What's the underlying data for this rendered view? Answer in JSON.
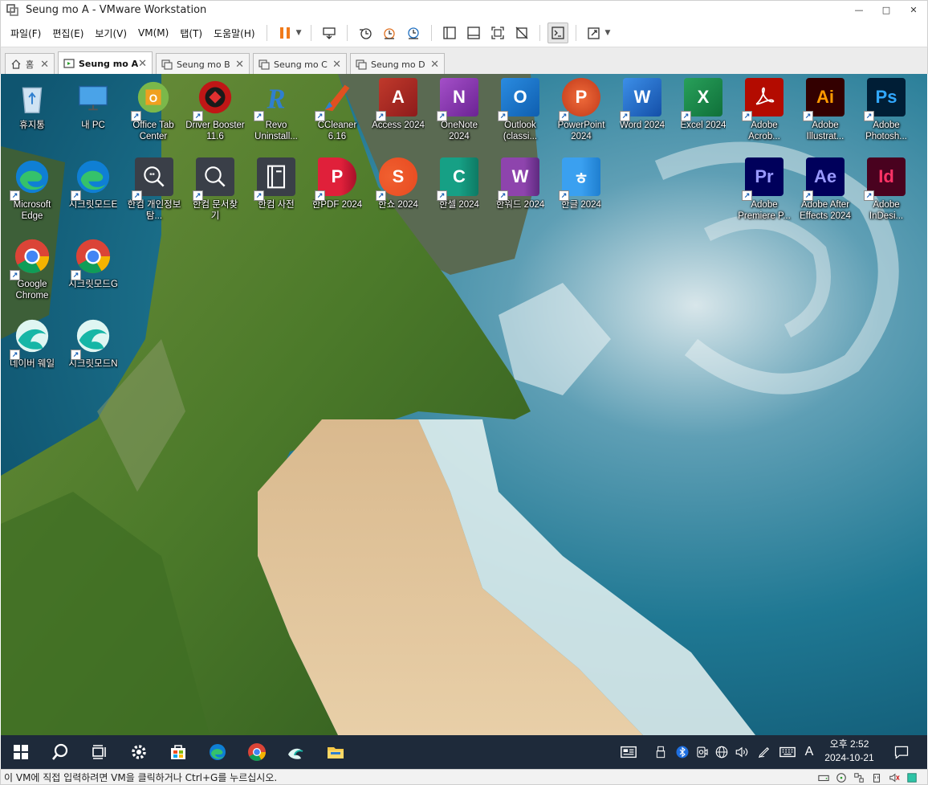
{
  "window": {
    "title": "Seung mo A - VMware Workstation",
    "controls": {
      "minimize": "—",
      "maximize": "□",
      "close": "✕"
    }
  },
  "menu": [
    "파일(F)",
    "편집(E)",
    "보기(V)",
    "VM(M)",
    "탭(T)",
    "도움말(H)"
  ],
  "tabs": [
    {
      "label": "홈",
      "icon": "home-icon"
    },
    {
      "label": "Seung mo A",
      "icon": "vm-running-icon",
      "active": true
    },
    {
      "label": "Seung mo B",
      "icon": "vm-icon"
    },
    {
      "label": "Seung mo C",
      "icon": "vm-icon"
    },
    {
      "label": "Seung mo D",
      "icon": "vm-icon"
    }
  ],
  "tab_close": "✕",
  "desktop": {
    "icons": [
      {
        "label": "휴지통",
        "icon": "recycle-bin-icon"
      },
      {
        "label": "내 PC",
        "icon": "this-pc-icon"
      },
      {
        "label": "Office Tab Center",
        "icon": "office-tab-icon"
      },
      {
        "label": "Driver Booster 11.6",
        "icon": "driver-booster-icon"
      },
      {
        "label": "Revo Uninstall...",
        "icon": "revo-uninstaller-icon"
      },
      {
        "label": "CCleaner 6.16",
        "icon": "ccleaner-icon"
      },
      {
        "label": "Access 2024",
        "icon": "access-icon",
        "glyph": "A"
      },
      {
        "label": "OneNote 2024",
        "icon": "onenote-icon",
        "glyph": "N"
      },
      {
        "label": "Outlook (classi...",
        "icon": "outlook-icon",
        "glyph": "O"
      },
      {
        "label": "PowerPoint 2024",
        "icon": "powerpoint-icon",
        "glyph": "P"
      },
      {
        "label": "Word 2024",
        "icon": "word-icon",
        "glyph": "W"
      },
      {
        "label": "Excel 2024",
        "icon": "excel-icon",
        "glyph": "X"
      },
      {
        "label": "Adobe Acrob...",
        "icon": "acrobat-icon"
      },
      {
        "label": "Adobe Illustrat...",
        "icon": "illustrator-icon",
        "glyph": "Ai"
      },
      {
        "label": "Adobe Photosh...",
        "icon": "photoshop-icon",
        "glyph": "Ps"
      },
      {
        "label": "Microsoft Edge",
        "icon": "edge-icon"
      },
      {
        "label": "시크릿모드E",
        "icon": "edge-icon"
      },
      {
        "label": "한컴 개인정보탐...",
        "icon": "hancom-privacy-icon"
      },
      {
        "label": "한컴 문서찾기",
        "icon": "hancom-search-icon"
      },
      {
        "label": "한컴 사전",
        "icon": "hancom-dictionary-icon"
      },
      {
        "label": "한PDF 2024",
        "icon": "hanpdf-icon",
        "glyph": "P"
      },
      {
        "label": "한쇼 2024",
        "icon": "hanshow-icon",
        "glyph": "S"
      },
      {
        "label": "한셀 2024",
        "icon": "hancell-icon",
        "glyph": "C"
      },
      {
        "label": "한워드 2024",
        "icon": "hanword-icon",
        "glyph": "W"
      },
      {
        "label": "한글 2024",
        "icon": "hangul-icon",
        "glyph": "ㅎ"
      },
      {
        "label": "Adobe Premiere P...",
        "icon": "premiere-icon",
        "glyph": "Pr"
      },
      {
        "label": "Adobe After Effects 2024",
        "icon": "after-effects-icon",
        "glyph": "Ae"
      },
      {
        "label": "Adobe InDesi...",
        "icon": "indesign-icon",
        "glyph": "Id"
      },
      {
        "label": "Google Chrome",
        "icon": "chrome-icon"
      },
      {
        "label": "시크릿모드G",
        "icon": "chrome-icon"
      },
      {
        "label": "네이버 웨일",
        "icon": "whale-icon"
      },
      {
        "label": "시크릿모드N",
        "icon": "whale-icon"
      }
    ]
  },
  "taskbar": {
    "items": [
      "start-icon",
      "search-icon",
      "task-view-icon",
      "settings-icon",
      "store-icon",
      "edge-icon",
      "chrome-icon",
      "whale-icon",
      "file-explorer-icon"
    ],
    "ime": "A",
    "clock_time": "오후 2:52",
    "clock_date": "2024-10-21"
  },
  "status": {
    "hint": "이 VM에 직접 입력하려면 VM을 클릭하거나 Ctrl+G를 누르십시오."
  },
  "colors": {
    "accent_pause": "#f07a1a",
    "taskbar_bg": "#1e2a3a",
    "sea": "#1a6b8a"
  }
}
